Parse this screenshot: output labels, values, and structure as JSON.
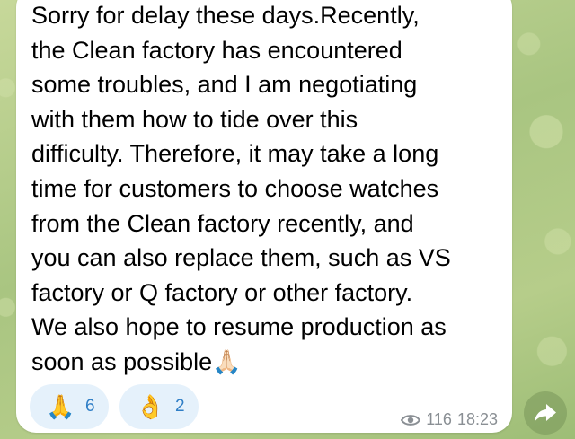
{
  "message": {
    "text": "Sorry for delay these days.Recently,\nthe Clean factory has encountered\nsome troubles, and I am negotiating\nwith them how to tide over this\ndifficulty. Therefore, it may take a long\ntime for customers to choose watches\nfrom the Clean factory recently, and\nyou can also replace them, such as VS\nfactory or Q factory or other factory.\nWe also hope to resume production as\nsoon as possible",
    "trailing_emoji": "🙏🏻",
    "views": "116",
    "time": "18:23"
  },
  "reactions": [
    {
      "emoji": "🙏",
      "count": "6"
    },
    {
      "emoji": "👌",
      "count": "2"
    }
  ],
  "icons": {
    "views": "eye-icon",
    "forward": "forward-arrow-icon"
  },
  "colors": {
    "bubble": "#ffffff",
    "reaction_bg": "#e5f1fb",
    "reaction_count": "#2f7ec6",
    "meta_text": "#8a8f94",
    "chat_background": "#b9cf8c"
  }
}
